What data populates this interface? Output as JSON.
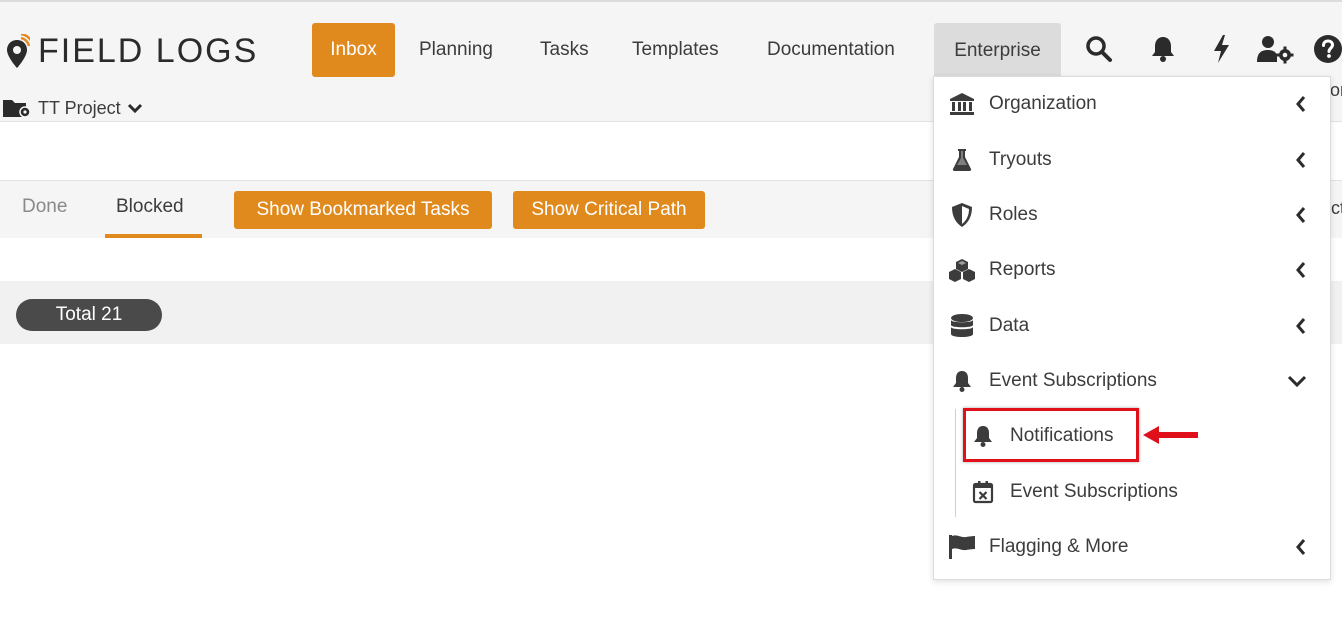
{
  "brand": {
    "name": "FIELD LOGS"
  },
  "nav": {
    "items": [
      {
        "label": "Inbox"
      },
      {
        "label": "Planning"
      },
      {
        "label": "Tasks"
      },
      {
        "label": "Templates"
      },
      {
        "label": "Documentation"
      },
      {
        "label": "Enterprise"
      }
    ],
    "active": "Inbox",
    "open_menu": "Enterprise"
  },
  "top_icons": [
    "search-icon",
    "bell-icon",
    "lightning-icon",
    "user-gear-icon",
    "help-icon"
  ],
  "project": {
    "label": "TT Project"
  },
  "tabs": [
    {
      "label": "Done"
    },
    {
      "label": "Blocked"
    }
  ],
  "actions": {
    "bookmarked": "Show Bookmarked Tasks",
    "critical": "Show Critical Path"
  },
  "total": {
    "label": "Total 21"
  },
  "clipped_text": {
    "top_right": "or",
    "tabs_right": "ct"
  },
  "enterprise_menu": {
    "items": [
      {
        "label": "Organization",
        "icon": "bank-icon"
      },
      {
        "label": "Tryouts",
        "icon": "flask-icon"
      },
      {
        "label": "Roles",
        "icon": "shield-icon"
      },
      {
        "label": "Reports",
        "icon": "cubes-icon"
      },
      {
        "label": "Data",
        "icon": "database-icon"
      },
      {
        "label": "Event Subscriptions",
        "icon": "bell-icon",
        "expanded": true
      },
      {
        "label": "Flagging & More",
        "icon": "flag-icon"
      }
    ],
    "submenu": [
      {
        "label": "Notifications",
        "icon": "bell-icon",
        "highlighted": true
      },
      {
        "label": "Event Subscriptions",
        "icon": "calendar-x-icon"
      }
    ]
  },
  "colors": {
    "accent": "#e08a1e",
    "highlight": "#e0101a",
    "pill": "#4a4a4a"
  }
}
